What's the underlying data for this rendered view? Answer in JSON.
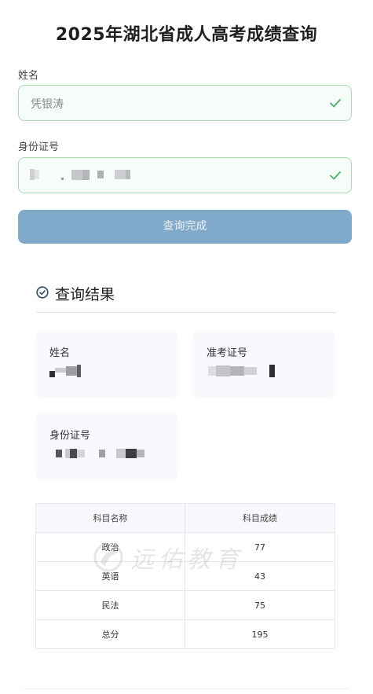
{
  "page": {
    "title": "2025年湖北省成人高考成绩查询"
  },
  "form": {
    "name_label": "姓名",
    "name_value": "凭银涛",
    "id_label": "身份证号",
    "query_button": "查询完成"
  },
  "result": {
    "header": "查询结果",
    "name_label": "姓名",
    "exam_no_label": "准考证号",
    "id_label": "身份证号"
  },
  "scores": {
    "columns": [
      "科目名称",
      "科目成绩"
    ],
    "rows": [
      {
        "subject": "政治",
        "score": "77"
      },
      {
        "subject": "英语",
        "score": "43"
      },
      {
        "subject": "民法",
        "score": "75"
      },
      {
        "subject": "总分",
        "score": "195"
      }
    ]
  },
  "watermark": {
    "text": "远佑教育"
  },
  "colors": {
    "valid_border": "#a8dcb3",
    "check_green": "#4caf6a",
    "button_bg": "#80a9ca",
    "card_bg": "#f7f9fc"
  }
}
